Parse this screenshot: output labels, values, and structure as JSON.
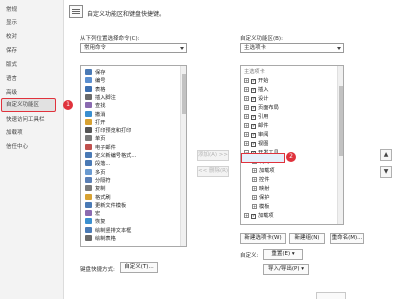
{
  "nav": {
    "items": [
      "常规",
      "显示",
      "校对",
      "保存",
      "版式",
      "语言",
      "高级",
      "自定义功能区",
      "快速访问工具栏",
      "加载项",
      "信任中心"
    ],
    "selected_index": 7,
    "badge": "1"
  },
  "header": {
    "title": "自定义功能区和键盘快捷键。"
  },
  "left": {
    "label": "从下列位置选择命令(C):",
    "dropdown_value": "常用命令",
    "commands": [
      "保存",
      "编号",
      "表格",
      "插入脚注",
      "查找",
      "撤消",
      "打开",
      "打印预览和打印",
      "单页",
      "电子邮件",
      "定义新编号格式...",
      "段落...",
      "多页",
      "分隔符",
      "复制",
      "格式刷",
      "更新文件模板",
      "宏",
      "恢复",
      "绘制竖排文本框",
      "绘制表格"
    ]
  },
  "middle": {
    "add_label": "添加(A) >>",
    "remove_label": "<< 删除(R)"
  },
  "right": {
    "label": "自定义功能区(B):",
    "dropdown_value": "主选项卡",
    "tree_header": "主选项卡",
    "tree": [
      {
        "toggle": "+",
        "checked": true,
        "label": "开始",
        "level": 0
      },
      {
        "toggle": "+",
        "checked": true,
        "label": "插入",
        "level": 0
      },
      {
        "toggle": "+",
        "checked": true,
        "label": "设计",
        "level": 0
      },
      {
        "toggle": "+",
        "checked": true,
        "label": "页面布局",
        "level": 0
      },
      {
        "toggle": "+",
        "checked": true,
        "label": "引用",
        "level": 0
      },
      {
        "toggle": "+",
        "checked": true,
        "label": "邮件",
        "level": 0
      },
      {
        "toggle": "+",
        "checked": true,
        "label": "审阅",
        "level": 0
      },
      {
        "toggle": "+",
        "checked": true,
        "label": "视图",
        "level": 0
      },
      {
        "toggle": "−",
        "checked": true,
        "label": "开发工具",
        "level": 0
      },
      {
        "toggle": "+",
        "checked": null,
        "label": "代码",
        "level": 1
      },
      {
        "toggle": "+",
        "checked": null,
        "label": "加载项",
        "level": 1
      },
      {
        "toggle": "+",
        "checked": null,
        "label": "控件",
        "level": 1
      },
      {
        "toggle": "+",
        "checked": null,
        "label": "映射",
        "level": 1
      },
      {
        "toggle": "+",
        "checked": null,
        "label": "保护",
        "level": 1
      },
      {
        "toggle": "+",
        "checked": null,
        "label": "模板",
        "level": 1
      },
      {
        "toggle": "+",
        "checked": true,
        "label": "加载项",
        "level": 0
      }
    ],
    "badge": "2",
    "new_tab_label": "新建选项卡(W)",
    "new_group_label": "新建组(N)",
    "rename_label": "重命名(M)...",
    "custom_label": "自定义:",
    "reset_label": "重置(E) ▾",
    "import_export_label": "导入/导出(P) ▾"
  },
  "keyboard": {
    "label": "键盘快捷方式:",
    "button_label": "自定义(T)..."
  },
  "icon_colors": [
    "#4a7ab5",
    "#5b8fd0",
    "#3d6fb0",
    "#6a6a6a",
    "#8a6ab0",
    "#3a8fd0",
    "#d8a232",
    "#555555",
    "#7a7a7a",
    "#c0504d",
    "#4a7ab5",
    "#4a7ab5",
    "#6a9ad0",
    "#5a7fb5",
    "#7a7a7a",
    "#d8a232",
    "#4a7ab5",
    "#8a6ab0",
    "#3a8fd0",
    "#4a7ab5",
    "#6a6a6a"
  ]
}
